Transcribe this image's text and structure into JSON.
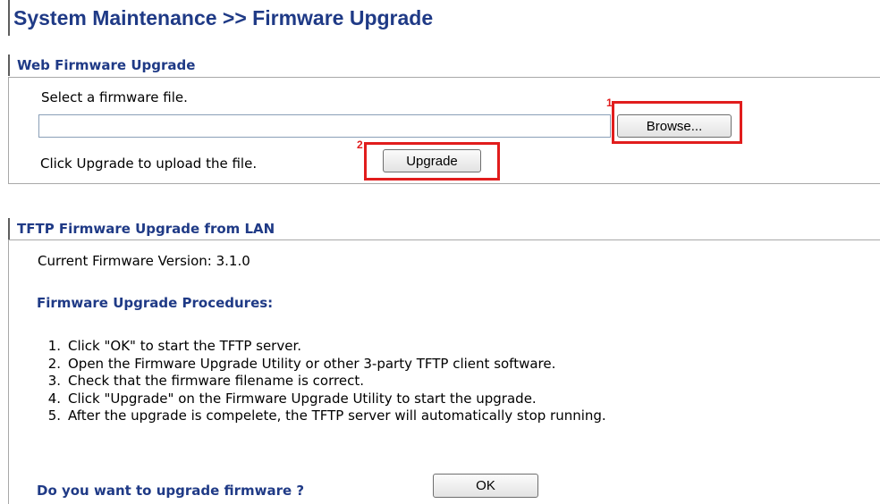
{
  "page": {
    "title": "System Maintenance >> Firmware Upgrade"
  },
  "web_upgrade": {
    "header": "Web Firmware Upgrade",
    "select_label": "Select a firmware file.",
    "file_value": "",
    "browse_label": "Browse...",
    "upload_label": "Click Upgrade to upload the file.",
    "upgrade_label": "Upgrade",
    "marker_1": "1",
    "marker_2": "2"
  },
  "tftp_upgrade": {
    "header": "TFTP Firmware Upgrade from LAN",
    "current_version": "Current Firmware Version: 3.1.0",
    "procedures_title": "Firmware Upgrade Procedures:",
    "steps": [
      {
        "num": "1.",
        "text": "Click \"OK\" to start the TFTP server."
      },
      {
        "num": "2.",
        "text": "Open the Firmware Upgrade Utility or other 3-party TFTP client software."
      },
      {
        "num": "3.",
        "text": "Check that the firmware filename is correct."
      },
      {
        "num": "4.",
        "text": "Click \"Upgrade\" on the Firmware Upgrade Utility to start the upgrade."
      },
      {
        "num": "5.",
        "text": "After the upgrade is compelete, the TFTP server will automatically stop running."
      }
    ],
    "question": "Do you want to upgrade firmware ?",
    "ok_label": "OK"
  },
  "colors": {
    "heading": "#1f3a86",
    "highlight": "#e11d1d",
    "border": "#a8a8a8"
  }
}
